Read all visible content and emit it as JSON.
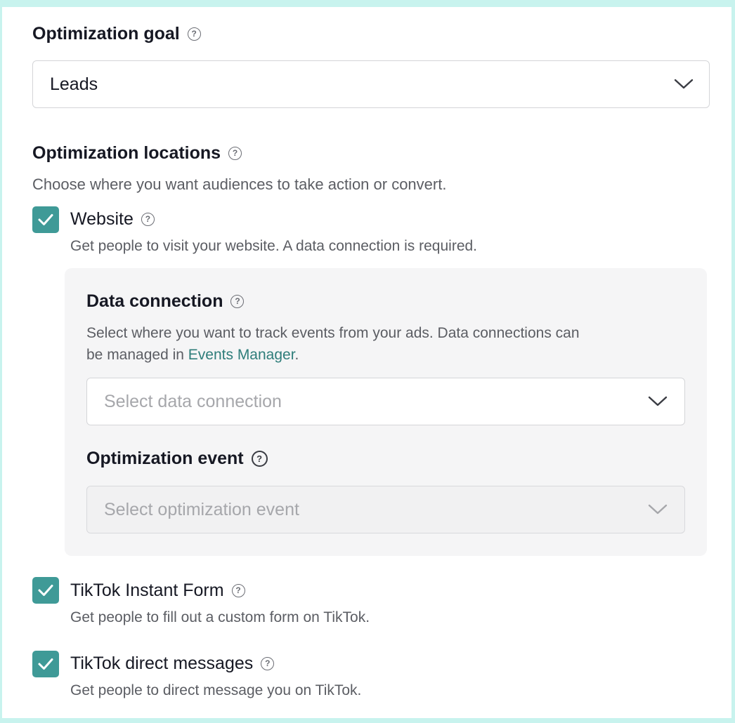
{
  "optimization_goal": {
    "title": "Optimization goal",
    "selected": "Leads"
  },
  "optimization_locations": {
    "title": "Optimization locations",
    "description": "Choose where you want audiences to take action or convert.",
    "options": [
      {
        "label": "Website",
        "description": "Get people to visit your website. A data connection is required.",
        "checked": true
      },
      {
        "label": "TikTok Instant Form",
        "description": "Get people to fill out a custom form on TikTok.",
        "checked": true
      },
      {
        "label": "TikTok direct messages",
        "description": "Get people to direct message you on TikTok.",
        "checked": true
      }
    ]
  },
  "data_connection": {
    "title": "Data connection",
    "description_line1": "Select where you want to track events from your ads. Data connections can",
    "description_line2_prefix": "be managed in ",
    "link_text": "Events Manager",
    "description_line2_suffix": ".",
    "placeholder": "Select data connection"
  },
  "optimization_event": {
    "title": "Optimization event",
    "placeholder": "Select optimization event",
    "disabled": true
  },
  "colors": {
    "accent": "#3f9a97",
    "link": "#2e7d7a",
    "frame": "#c8f3ee"
  },
  "icons": {
    "help": "question-circle-icon",
    "chevron": "chevron-down-icon",
    "check": "checkmark-icon"
  }
}
